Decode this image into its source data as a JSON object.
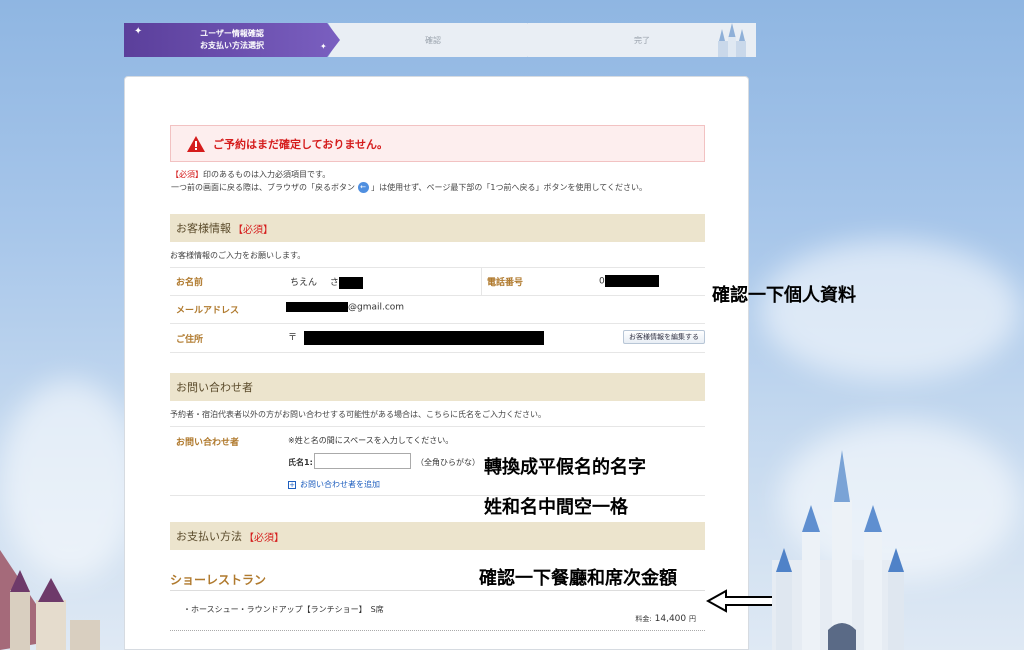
{
  "steps": {
    "step1_line1": "ユーザー情報確認",
    "step1_line2": "お支払い方法選択",
    "step2": "確認",
    "step3": "完了"
  },
  "alert": {
    "text": "ご予約はまだ確定しておりません。"
  },
  "notes": {
    "required_tag": "【必須】",
    "required_rest": "印のあるものは入力必須項目です。",
    "back_before": "一つ前の画面に戻る際は、ブラウザの「戻るボタン",
    "back_after": "」は使用せず、ページ最下部の「1つ前へ戻る」ボタンを使用してください。"
  },
  "customer": {
    "title": "お客様情報",
    "required": "【必須】",
    "desc": "お客様情報のご入力をお願いします。",
    "name_label": "お名前",
    "name_value": "ちえん",
    "name_suffix": "さ",
    "phone_label": "電話番号",
    "phone_prefix": "0",
    "email_label": "メールアドレス",
    "email_domain": "@gmail.com",
    "address_label": "ご住所",
    "address_prefix": "〒",
    "edit_button": "お客様情報を編集する"
  },
  "contact": {
    "title": "お問い合わせ者",
    "desc": "予約者・宿泊代表者以外の方がお問い合わせする可能性がある場合は、こちらに氏名をご入力ください。",
    "label": "お問い合わせ者",
    "hint": "※姓と名の間にスペースを入力してください。",
    "name_label": "氏名1:",
    "name_value": "",
    "kana_note": "（全角ひらがな）",
    "add_link": "お問い合わせ者を追加"
  },
  "payment": {
    "title": "お支払い方法",
    "required": "【必須】"
  },
  "show": {
    "title": "ショーレストラン",
    "item": "・ホースシュー・ラウンドアップ【ランチショー】　S席",
    "price_label": "料金:",
    "price_value": "14,400",
    "price_unit": "円"
  },
  "annotations": {
    "a1": "確認一下個人資料",
    "a2": "轉換成平假名的名字",
    "a3": "姓和名中間空一格",
    "a4": "確認一下餐廳和席次金額"
  },
  "colors": {
    "accent_purple": "#5b3f9b",
    "required_red": "#d51c1c",
    "label_gold": "#b07a2e",
    "section_beige": "#ece4cd"
  }
}
